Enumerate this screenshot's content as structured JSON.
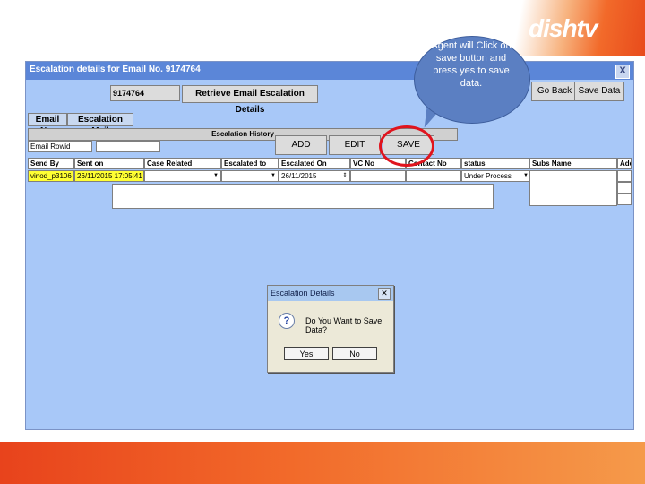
{
  "window": {
    "title": "Escalation details for Email No. 9174764",
    "email_no_value": "9174764",
    "retrieve_button": "Retrieve Email Escalation Details",
    "go_back_button": "Go Back",
    "save_data_button": "Save Data",
    "close_glyph": "X"
  },
  "tabs": [
    "Email No.",
    "Escalation Mail"
  ],
  "history": {
    "heading": "Escalation History",
    "email_rowid_label": "Email Rowid",
    "add_button": "ADD",
    "edit_button": "EDIT",
    "save_button": "SAVE"
  },
  "columns": [
    "Send By",
    "Sent on",
    "Case Related",
    "Escalated to",
    "Escalated On",
    "VC No",
    "Contact No",
    "status",
    "Subs Name",
    "Add"
  ],
  "row": {
    "send_by": "vinod_p3106",
    "sent_on": "26/11/2015 17:05:41",
    "case_related": "",
    "escalated_to": "",
    "escalated_on": "26/11/2015",
    "vc_no": "",
    "contact_no": "",
    "status": "Under Process"
  },
  "dialog": {
    "title": "Escalation Details",
    "message": "Do You Want to Save Data?",
    "yes_button": "Yes",
    "no_button": "No",
    "icon": "question-icon"
  },
  "callout": {
    "text": "Agent will Click on save button and press yes to save data."
  },
  "brand": {
    "logo_text": "dishtv",
    "accent_color": "#f26a2a"
  }
}
